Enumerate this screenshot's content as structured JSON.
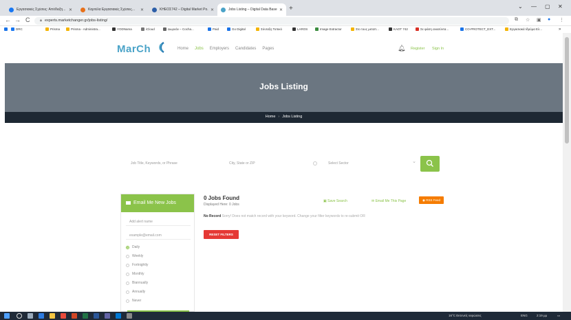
{
  "browser": {
    "tabs": [
      {
        "title": "Εργασιακές Σχέσεις: Απόδειξη...",
        "color": "#1877f2",
        "active": false
      },
      {
        "title": "Καρτέλα Εργασιακές Σχέσεις...",
        "color": "#e8711a",
        "active": false
      },
      {
        "title": "ΚΗΕΟΣ742 – Digital Market Po...",
        "color": "#2c5ea8",
        "active": false
      },
      {
        "title": "Jobs Listing – Digital Data Base ...",
        "color": "#4aa3c8",
        "active": true
      }
    ],
    "new_tab": "+",
    "window_controls": [
      "⌄",
      "—",
      "▢",
      "✕"
    ],
    "url": "experts.marketchanger.gr/jobs-listing/",
    "toolbar_icons": [
      "←",
      "→",
      "C"
    ],
    "right_icons": [
      "⧉",
      "☆",
      "▣",
      "●",
      "⋮"
    ],
    "bookmarks": [
      {
        "label": "DRC",
        "color": "#1877f2"
      },
      {
        "label": "Prisma",
        "color": "#f4b400"
      },
      {
        "label": "Prisma - Administra...",
        "color": "#f4b400"
      },
      {
        "label": "YODNama",
        "color": "#333333"
      },
      {
        "label": "iCloud",
        "color": "#777777"
      },
      {
        "label": "Δωρεάν – Cocha...",
        "color": "#666666"
      },
      {
        "label": "Paid",
        "color": "#1a73e8"
      },
      {
        "label": "Go Digital",
        "color": "#1a73e8"
      },
      {
        "label": "Σύνταξη Τοπικό",
        "color": "#f4b400"
      },
      {
        "label": "LAROS",
        "color": "#333333"
      },
      {
        "label": "Image Extractor",
        "color": "#3c8d40"
      },
      {
        "label": "Στο τους μεταπ...",
        "color": "#f4b400"
      },
      {
        "label": "ΚΑΟΤ 742",
        "color": "#333333"
      },
      {
        "label": "Σε φάση ανασύντα...",
        "color": "#d93025"
      },
      {
        "label": "CO-PROTECT_EXT...",
        "color": "#1a73e8"
      },
      {
        "label": "Εργασιακά Ιδρύμα Ελ...",
        "color": "#f4b400"
      }
    ]
  },
  "site": {
    "logo": "MarCh",
    "nav": [
      "Home",
      "Jobs",
      "Employers",
      "Candidates",
      "Pages"
    ],
    "active_nav_index": 1,
    "register": "Register",
    "signin": "Sign In",
    "accent": "#8bc34a"
  },
  "banner": {
    "title": "Jobs Listing",
    "breadcrumb": [
      "Home",
      "Jobs Listing"
    ],
    "separator": "›"
  },
  "search": {
    "keyword_placeholder": "Job Title, Keywords, or Phrase",
    "location_placeholder": "City, State or ZIP",
    "sector_placeholder": "Select Sector",
    "button_icon": "search-icon"
  },
  "alert": {
    "title": "Email Me New Jobs",
    "name_placeholder": "Add alert name",
    "email_placeholder": "example@email.com",
    "frequencies": [
      "Daily",
      "Weekly",
      "Fortnightly",
      "Monthly",
      "Biannually",
      "Annually",
      "Never"
    ],
    "selected_frequency": "Daily"
  },
  "results": {
    "count_text": "0 Jobs Found",
    "displayed_text": "Displayed Here: 0 Jobs",
    "save_search": "Save Search",
    "email_page": "Email Me This Page",
    "rss": "RSS Feed",
    "no_record_label": "No Record",
    "no_record_text": "Sorry! Does not match record with your keyword. Change your filter keywords to re-submit OR",
    "reset_button": "RESET FILTERS"
  },
  "taskbar": {
    "weather": "16°C Εκτενείς νεφώσεις",
    "lang": "ENG",
    "time": "2:19 μμ"
  }
}
